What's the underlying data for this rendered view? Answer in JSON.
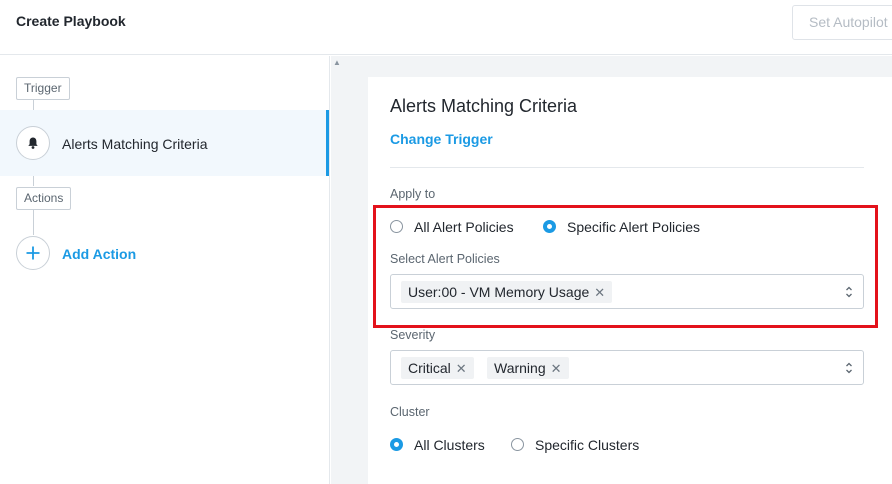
{
  "header": {
    "title": "Create Playbook",
    "autopilot_button": "Set Autopilot"
  },
  "sidebar": {
    "trigger_tag": "Trigger",
    "trigger_item": "Alerts Matching Criteria",
    "actions_tag": "Actions",
    "add_action": "Add Action"
  },
  "form": {
    "title": "Alerts Matching Criteria",
    "change_trigger": "Change Trigger",
    "apply_to": {
      "label": "Apply to",
      "options": [
        "All Alert Policies",
        "Specific Alert Policies"
      ],
      "selected": "Specific Alert Policies"
    },
    "select_policies": {
      "label": "Select Alert Policies",
      "tags": [
        "User:00 - VM Memory Usage"
      ]
    },
    "severity": {
      "label": "Severity",
      "tags": [
        "Critical",
        "Warning"
      ]
    },
    "cluster": {
      "label": "Cluster",
      "options": [
        "All Clusters",
        "Specific Clusters"
      ],
      "selected": "All Clusters"
    }
  },
  "colors": {
    "accent": "#1b9ae4",
    "highlight": "#e3121b",
    "panel_bg": "#f2f4f6"
  }
}
